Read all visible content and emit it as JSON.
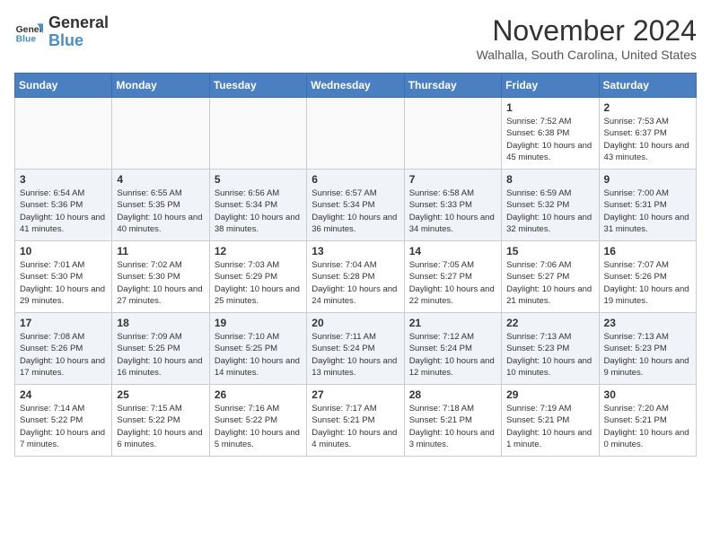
{
  "header": {
    "logo_line1": "General",
    "logo_line2": "Blue",
    "month": "November 2024",
    "location": "Walhalla, South Carolina, United States"
  },
  "weekdays": [
    "Sunday",
    "Monday",
    "Tuesday",
    "Wednesday",
    "Thursday",
    "Friday",
    "Saturday"
  ],
  "weeks": [
    [
      {
        "day": "",
        "info": ""
      },
      {
        "day": "",
        "info": ""
      },
      {
        "day": "",
        "info": ""
      },
      {
        "day": "",
        "info": ""
      },
      {
        "day": "",
        "info": ""
      },
      {
        "day": "1",
        "info": "Sunrise: 7:52 AM\nSunset: 6:38 PM\nDaylight: 10 hours and 45 minutes."
      },
      {
        "day": "2",
        "info": "Sunrise: 7:53 AM\nSunset: 6:37 PM\nDaylight: 10 hours and 43 minutes."
      }
    ],
    [
      {
        "day": "3",
        "info": "Sunrise: 6:54 AM\nSunset: 5:36 PM\nDaylight: 10 hours and 41 minutes."
      },
      {
        "day": "4",
        "info": "Sunrise: 6:55 AM\nSunset: 5:35 PM\nDaylight: 10 hours and 40 minutes."
      },
      {
        "day": "5",
        "info": "Sunrise: 6:56 AM\nSunset: 5:34 PM\nDaylight: 10 hours and 38 minutes."
      },
      {
        "day": "6",
        "info": "Sunrise: 6:57 AM\nSunset: 5:34 PM\nDaylight: 10 hours and 36 minutes."
      },
      {
        "day": "7",
        "info": "Sunrise: 6:58 AM\nSunset: 5:33 PM\nDaylight: 10 hours and 34 minutes."
      },
      {
        "day": "8",
        "info": "Sunrise: 6:59 AM\nSunset: 5:32 PM\nDaylight: 10 hours and 32 minutes."
      },
      {
        "day": "9",
        "info": "Sunrise: 7:00 AM\nSunset: 5:31 PM\nDaylight: 10 hours and 31 minutes."
      }
    ],
    [
      {
        "day": "10",
        "info": "Sunrise: 7:01 AM\nSunset: 5:30 PM\nDaylight: 10 hours and 29 minutes."
      },
      {
        "day": "11",
        "info": "Sunrise: 7:02 AM\nSunset: 5:30 PM\nDaylight: 10 hours and 27 minutes."
      },
      {
        "day": "12",
        "info": "Sunrise: 7:03 AM\nSunset: 5:29 PM\nDaylight: 10 hours and 25 minutes."
      },
      {
        "day": "13",
        "info": "Sunrise: 7:04 AM\nSunset: 5:28 PM\nDaylight: 10 hours and 24 minutes."
      },
      {
        "day": "14",
        "info": "Sunrise: 7:05 AM\nSunset: 5:27 PM\nDaylight: 10 hours and 22 minutes."
      },
      {
        "day": "15",
        "info": "Sunrise: 7:06 AM\nSunset: 5:27 PM\nDaylight: 10 hours and 21 minutes."
      },
      {
        "day": "16",
        "info": "Sunrise: 7:07 AM\nSunset: 5:26 PM\nDaylight: 10 hours and 19 minutes."
      }
    ],
    [
      {
        "day": "17",
        "info": "Sunrise: 7:08 AM\nSunset: 5:26 PM\nDaylight: 10 hours and 17 minutes."
      },
      {
        "day": "18",
        "info": "Sunrise: 7:09 AM\nSunset: 5:25 PM\nDaylight: 10 hours and 16 minutes."
      },
      {
        "day": "19",
        "info": "Sunrise: 7:10 AM\nSunset: 5:25 PM\nDaylight: 10 hours and 14 minutes."
      },
      {
        "day": "20",
        "info": "Sunrise: 7:11 AM\nSunset: 5:24 PM\nDaylight: 10 hours and 13 minutes."
      },
      {
        "day": "21",
        "info": "Sunrise: 7:12 AM\nSunset: 5:24 PM\nDaylight: 10 hours and 12 minutes."
      },
      {
        "day": "22",
        "info": "Sunrise: 7:13 AM\nSunset: 5:23 PM\nDaylight: 10 hours and 10 minutes."
      },
      {
        "day": "23",
        "info": "Sunrise: 7:13 AM\nSunset: 5:23 PM\nDaylight: 10 hours and 9 minutes."
      }
    ],
    [
      {
        "day": "24",
        "info": "Sunrise: 7:14 AM\nSunset: 5:22 PM\nDaylight: 10 hours and 7 minutes."
      },
      {
        "day": "25",
        "info": "Sunrise: 7:15 AM\nSunset: 5:22 PM\nDaylight: 10 hours and 6 minutes."
      },
      {
        "day": "26",
        "info": "Sunrise: 7:16 AM\nSunset: 5:22 PM\nDaylight: 10 hours and 5 minutes."
      },
      {
        "day": "27",
        "info": "Sunrise: 7:17 AM\nSunset: 5:21 PM\nDaylight: 10 hours and 4 minutes."
      },
      {
        "day": "28",
        "info": "Sunrise: 7:18 AM\nSunset: 5:21 PM\nDaylight: 10 hours and 3 minutes."
      },
      {
        "day": "29",
        "info": "Sunrise: 7:19 AM\nSunset: 5:21 PM\nDaylight: 10 hours and 1 minute."
      },
      {
        "day": "30",
        "info": "Sunrise: 7:20 AM\nSunset: 5:21 PM\nDaylight: 10 hours and 0 minutes."
      }
    ]
  ]
}
